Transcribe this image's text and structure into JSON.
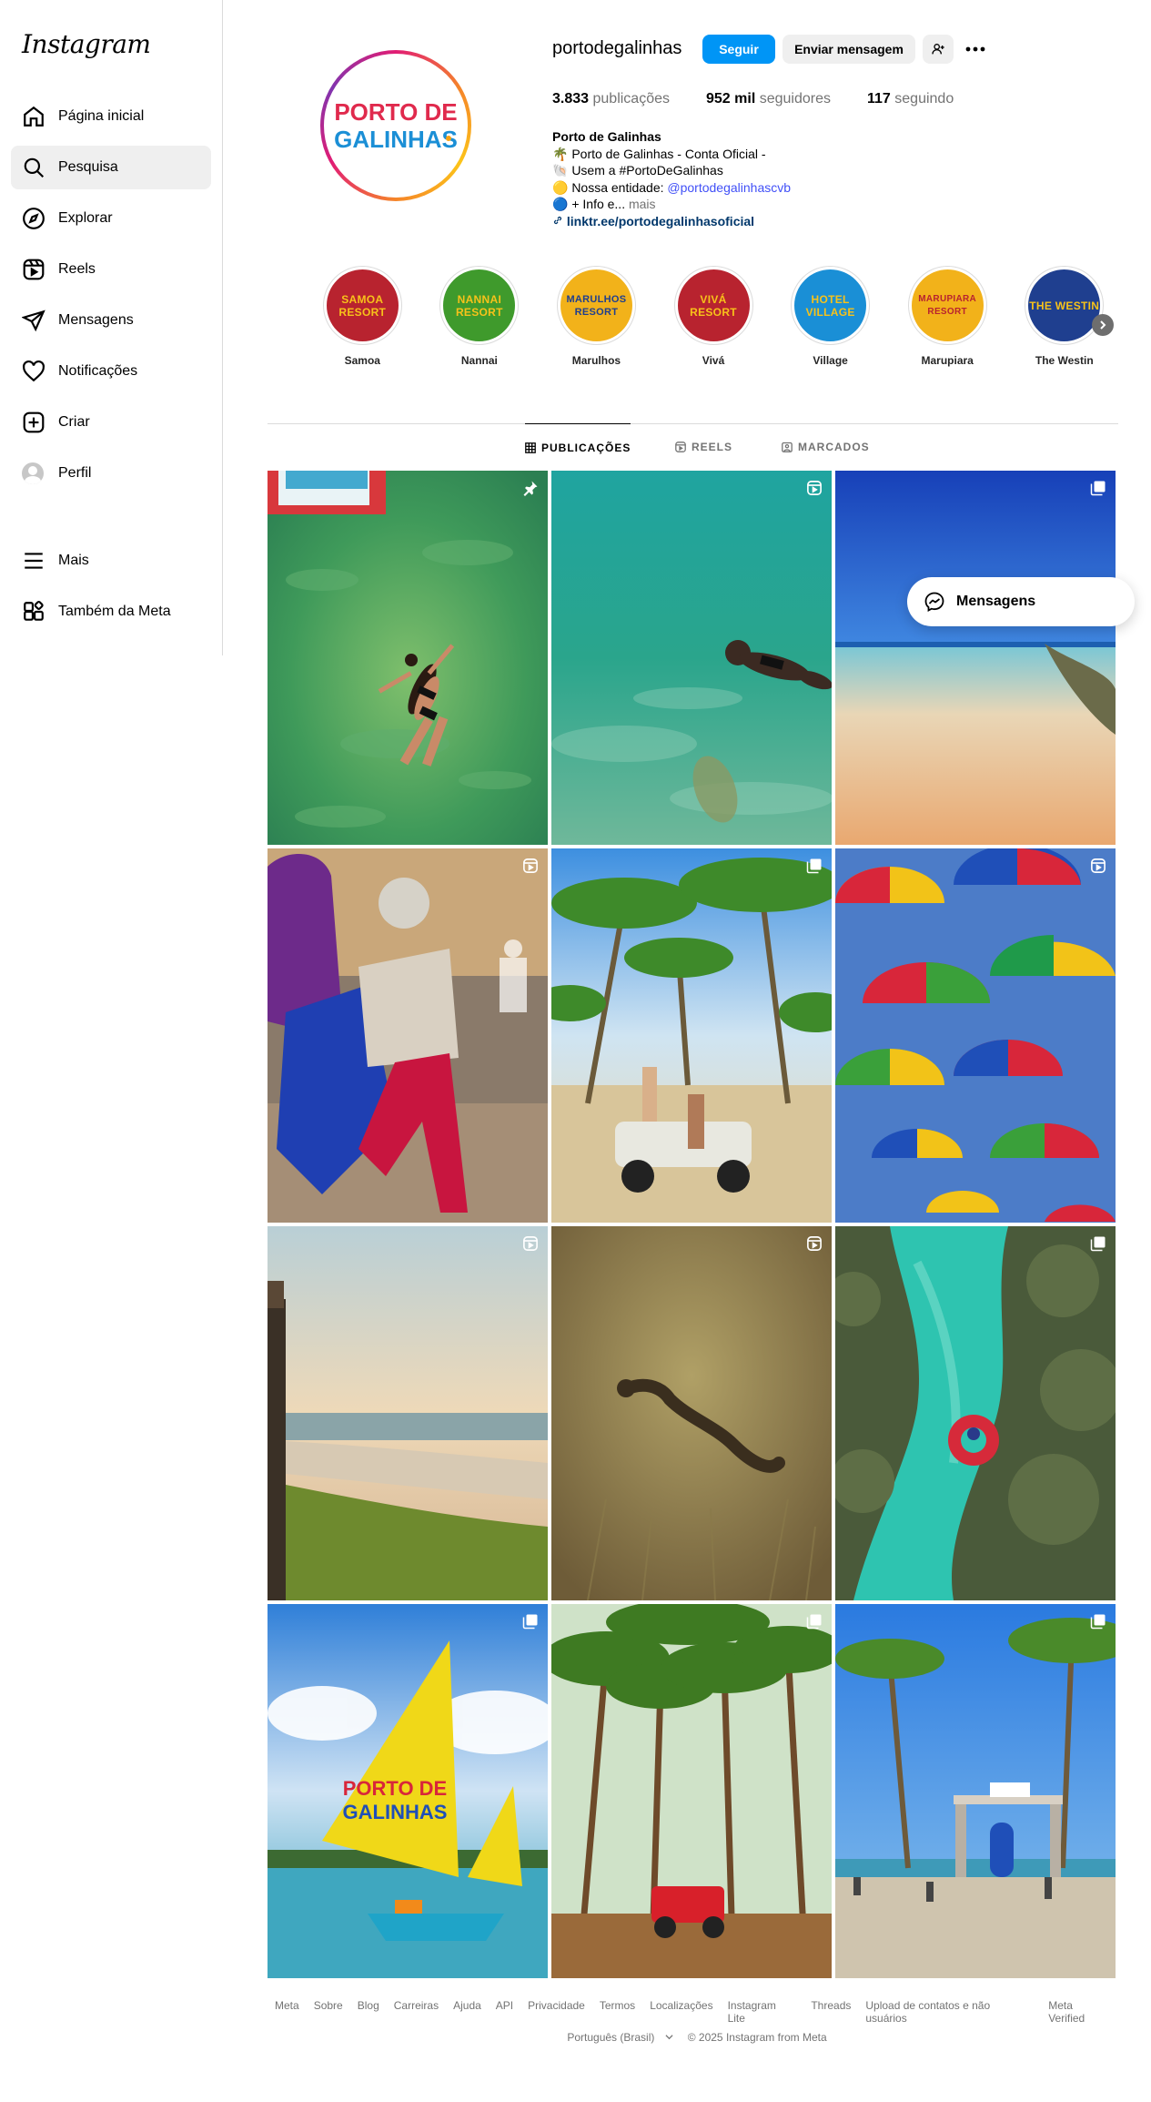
{
  "app": {
    "logo": "Instagram"
  },
  "sidebar": {
    "items": [
      {
        "label": "Página inicial",
        "icon": "home-icon"
      },
      {
        "label": "Pesquisa",
        "icon": "search-icon",
        "active": true
      },
      {
        "label": "Explorar",
        "icon": "compass-icon"
      },
      {
        "label": "Reels",
        "icon": "reels-icon"
      },
      {
        "label": "Mensagens",
        "icon": "paper-plane-icon"
      },
      {
        "label": "Notificações",
        "icon": "heart-icon"
      },
      {
        "label": "Criar",
        "icon": "plus-square-icon"
      },
      {
        "label": "Perfil",
        "icon": "avatar"
      }
    ],
    "lower": [
      {
        "label": "Mais",
        "icon": "menu-icon"
      },
      {
        "label": "Também da Meta",
        "icon": "meta-apps-icon"
      }
    ]
  },
  "profile": {
    "username": "portodegalinhas",
    "logo_text_top": "PORTO DE",
    "logo_text_bottom": "GALINHAS",
    "follow_label": "Seguir",
    "message_label": "Enviar mensagem",
    "stats": {
      "posts_value": "3.833",
      "posts_label": "publicações",
      "followers_value": "952 mil",
      "followers_label": "seguidores",
      "following_value": "117",
      "following_label": "seguindo"
    },
    "bio": {
      "name": "Porto de Galinhas",
      "line1": "🌴 Porto de Galinhas - Conta Oficial -",
      "line2": "🐚 Usem a #PortoDeGalinhas",
      "line3_prefix": "🟡 Nossa entidade: ",
      "line3_link": "@portodegalinhascvb",
      "line4": "🔵 + Info e...",
      "line4_more": "mais",
      "external_link": "linktr.ee/portodegalinhasoficial"
    }
  },
  "highlights": [
    {
      "label": "Samoa",
      "text": "SAMOA RESORT",
      "bg": "#b8232f",
      "fg": "#f7c21a"
    },
    {
      "label": "Nannai",
      "text": "NANNAI RESORT",
      "bg": "#3f9a2c",
      "fg": "#f7c21a"
    },
    {
      "label": "Marulhos",
      "text": "MARULHOS RESORT",
      "bg": "#f2b21a",
      "fg": "#1f3f8f"
    },
    {
      "label": "Vivá",
      "text": "VIVÁ RESORT",
      "bg": "#b8232f",
      "fg": "#f7c21a"
    },
    {
      "label": "Village",
      "text": "HOTEL VILLAGE",
      "bg": "#1a8fd6",
      "fg": "#f7c21a"
    },
    {
      "label": "Marupiara",
      "text": "MARUPIARA RESORT",
      "bg": "#f2b21a",
      "fg": "#b8232f"
    },
    {
      "label": "The Westin",
      "text": "THE WESTIN",
      "bg": "#1f3f8f",
      "fg": "#f7c21a"
    }
  ],
  "tabs": [
    {
      "label": "PUBLICAÇÕES",
      "active": true
    },
    {
      "label": "REELS"
    },
    {
      "label": "MARCADOS"
    }
  ],
  "messages_pill": "Mensagens",
  "posts": [
    {
      "badge": "pin-icon"
    },
    {
      "badge": "reel-icon"
    },
    {
      "badge": "carousel-icon"
    },
    {
      "badge": "reel-icon"
    },
    {
      "badge": "carousel-icon"
    },
    {
      "badge": "reel-icon"
    },
    {
      "badge": "reel-icon"
    },
    {
      "badge": "reel-icon"
    },
    {
      "badge": "carousel-icon"
    },
    {
      "badge": "carousel-icon"
    },
    {
      "badge": "carousel-icon"
    },
    {
      "badge": "carousel-icon"
    }
  ],
  "sail_text_top": "PORTO DE",
  "sail_text_bottom": "GALINHAS",
  "footer": {
    "links": [
      "Meta",
      "Sobre",
      "Blog",
      "Carreiras",
      "Ajuda",
      "API",
      "Privacidade",
      "Termos",
      "Localizações",
      "Instagram Lite",
      "Threads",
      "Upload de contatos e não usuários",
      "Meta Verified"
    ],
    "language": "Português (Brasil)",
    "copyright": "© 2025 Instagram from Meta"
  }
}
